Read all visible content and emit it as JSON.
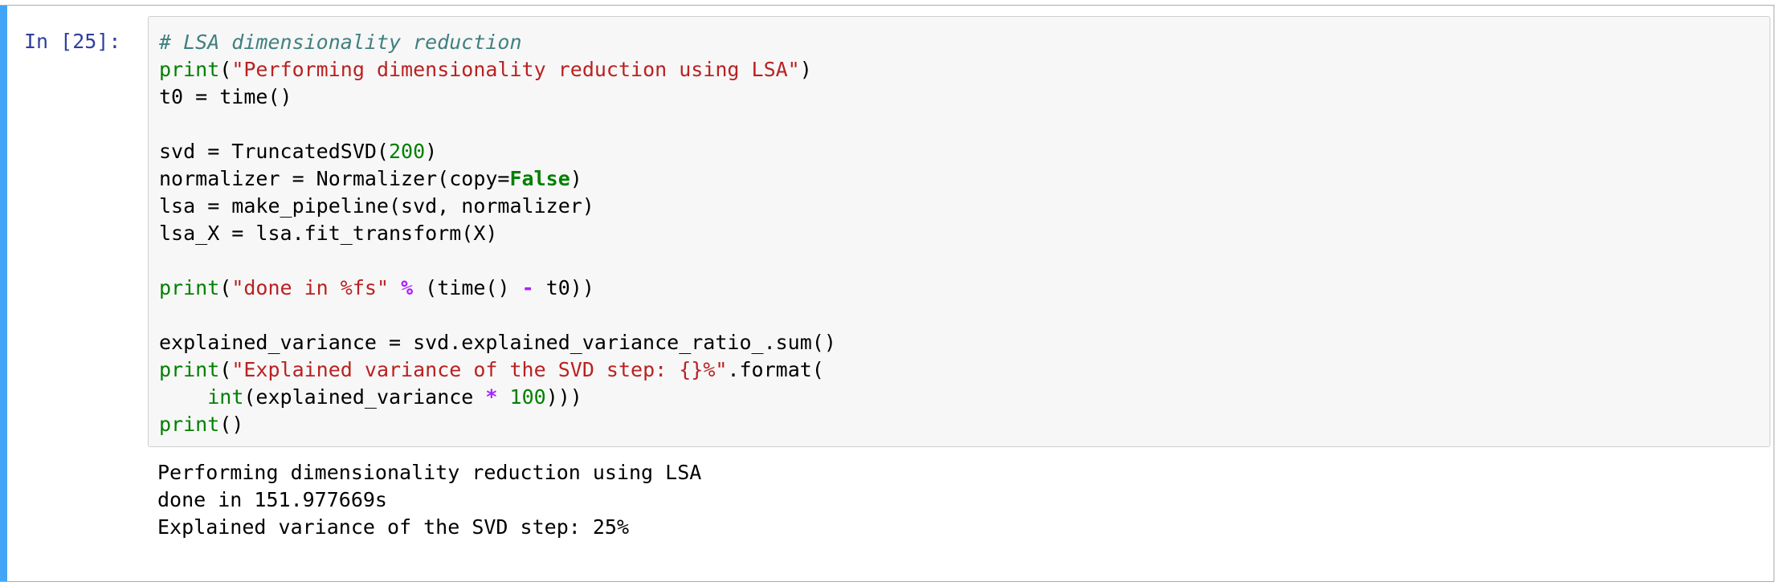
{
  "cell": {
    "prompt": "In [25]:",
    "code_lines": [
      [
        {
          "t": "# LSA dimensionality reduction",
          "c": "comment"
        }
      ],
      [
        {
          "t": "print",
          "c": "builtin"
        },
        {
          "t": "(",
          "c": ""
        },
        {
          "t": "\"Performing dimensionality reduction using LSA\"",
          "c": "string"
        },
        {
          "t": ")",
          "c": ""
        }
      ],
      [
        {
          "t": "t0 = time()",
          "c": ""
        }
      ],
      [],
      [
        {
          "t": "svd = TruncatedSVD(",
          "c": ""
        },
        {
          "t": "200",
          "c": "number"
        },
        {
          "t": ")",
          "c": ""
        }
      ],
      [
        {
          "t": "normalizer = Normalizer(copy=",
          "c": ""
        },
        {
          "t": "False",
          "c": "keyword"
        },
        {
          "t": ")",
          "c": ""
        }
      ],
      [
        {
          "t": "lsa = make_pipeline(svd, normalizer)",
          "c": ""
        }
      ],
      [
        {
          "t": "lsa_X = lsa.fit_transform(X)",
          "c": ""
        }
      ],
      [],
      [
        {
          "t": "print",
          "c": "builtin"
        },
        {
          "t": "(",
          "c": ""
        },
        {
          "t": "\"done in %fs\"",
          "c": "string"
        },
        {
          "t": " ",
          "c": ""
        },
        {
          "t": "%",
          "c": "op"
        },
        {
          "t": " (time() ",
          "c": ""
        },
        {
          "t": "-",
          "c": "op"
        },
        {
          "t": " t0))",
          "c": ""
        }
      ],
      [],
      [
        {
          "t": "explained_variance = svd.explained_variance_ratio_.sum()",
          "c": ""
        }
      ],
      [
        {
          "t": "print",
          "c": "builtin"
        },
        {
          "t": "(",
          "c": ""
        },
        {
          "t": "\"Explained variance of the SVD step: {}%\"",
          "c": "string"
        },
        {
          "t": ".format(",
          "c": ""
        }
      ],
      [
        {
          "t": "    ",
          "c": ""
        },
        {
          "t": "int",
          "c": "builtin"
        },
        {
          "t": "(explained_variance ",
          "c": ""
        },
        {
          "t": "*",
          "c": "op"
        },
        {
          "t": " ",
          "c": ""
        },
        {
          "t": "100",
          "c": "number"
        },
        {
          "t": ")))",
          "c": ""
        }
      ],
      [
        {
          "t": "print",
          "c": "builtin"
        },
        {
          "t": "()",
          "c": ""
        }
      ]
    ],
    "output_lines": [
      "Performing dimensionality reduction using LSA",
      "done in 151.977669s",
      "Explained variance of the SVD step: 25%"
    ]
  },
  "colors": {
    "selected_bar": "#42a5f5",
    "prompt": "#303f9f",
    "comment": "#408080",
    "builtin": "#008000",
    "string": "#ba2121",
    "keyword": "#008000",
    "operator": "#aa22ff"
  }
}
